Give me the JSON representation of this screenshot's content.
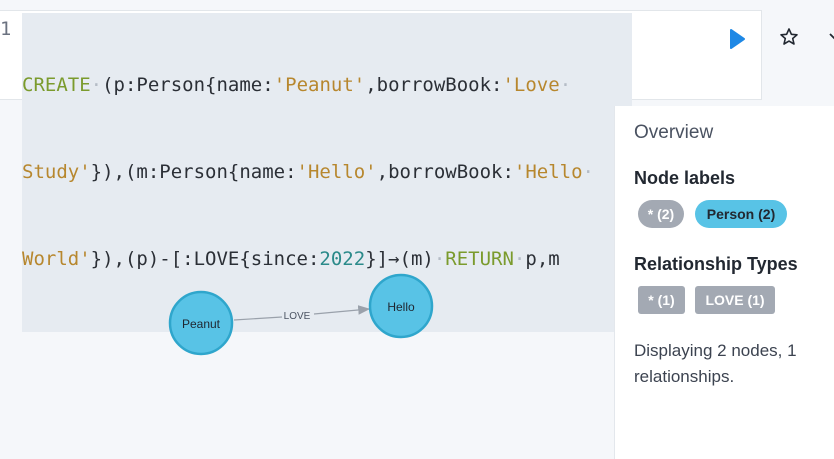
{
  "editor": {
    "line_number": "1",
    "line1": [
      {
        "t": "CREATE",
        "c": "kw"
      },
      {
        "t": "·",
        "c": "dot"
      },
      {
        "t": "(p:Person{name:",
        "c": "pl"
      },
      {
        "t": "'Peanut'",
        "c": "str"
      },
      {
        "t": ",borrowBook:",
        "c": "pl"
      },
      {
        "t": "'Love",
        "c": "str"
      },
      {
        "t": "·",
        "c": "dot"
      }
    ],
    "line2": [
      {
        "t": "Study'",
        "c": "str"
      },
      {
        "t": "}),(m:Person{name:",
        "c": "pl"
      },
      {
        "t": "'Hello'",
        "c": "str"
      },
      {
        "t": ",borrowBook:",
        "c": "pl"
      },
      {
        "t": "'Hello",
        "c": "str"
      },
      {
        "t": "·",
        "c": "dot"
      }
    ],
    "line3": [
      {
        "t": "World'",
        "c": "str"
      },
      {
        "t": "}),(p)-[:LOVE{since:",
        "c": "pl"
      },
      {
        "t": "2022",
        "c": "num"
      },
      {
        "t": "}]→(m)",
        "c": "pl"
      },
      {
        "t": "·",
        "c": "dot"
      },
      {
        "t": "RETURN",
        "c": "kw"
      },
      {
        "t": "·",
        "c": "dot"
      },
      {
        "t": "p,m",
        "c": "pl"
      }
    ]
  },
  "toolbar": {
    "run_icon": "play-icon",
    "favorite_icon": "star-icon",
    "more_icon": "chevron-icon"
  },
  "graph": {
    "nodes": [
      {
        "label": "Peanut"
      },
      {
        "label": "Hello"
      }
    ],
    "relationship": {
      "label": "LOVE"
    },
    "node_color": "#58c3e6",
    "node_border": "#2fa6cc"
  },
  "overview": {
    "title": "Overview",
    "node_labels_title": "Node labels",
    "node_chips": [
      {
        "label": "* (2)",
        "bg": "#a3a9b3",
        "fg": "#ffffff"
      },
      {
        "label": "Person (2)",
        "bg": "#58c3e6",
        "fg": "#222831"
      }
    ],
    "rel_types_title": "Relationship Types",
    "rel_chips": [
      {
        "label": "* (1)",
        "bg": "#a3a9b3",
        "fg": "#ffffff"
      },
      {
        "label": "LOVE (1)",
        "bg": "#a3a9b3",
        "fg": "#ffffff"
      }
    ],
    "summary": "Displaying 2 nodes, 1 relationships."
  }
}
